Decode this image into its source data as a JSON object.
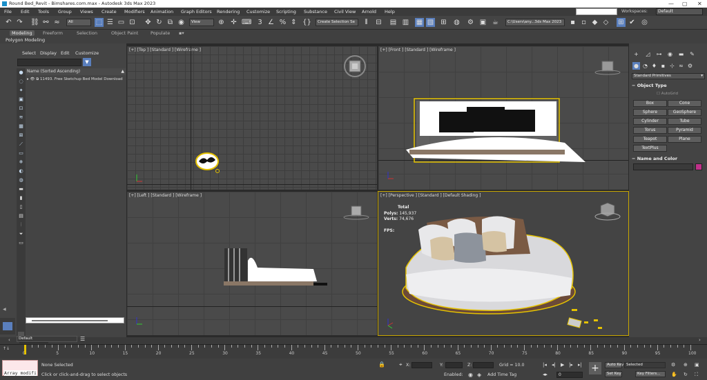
{
  "window": {
    "title": "Round Bed_Revit - Bimshares.com.max - Autodesk 3ds Max 2023",
    "controls": [
      "—",
      "▢",
      "✕"
    ]
  },
  "menu": [
    "File",
    "Edit",
    "Tools",
    "Group",
    "Views",
    "Create",
    "Modifiers",
    "Animation",
    "Graph Editors",
    "Rendering",
    "Customize",
    "Scripting",
    "Substance",
    "Civil View",
    "Arnold",
    "Help"
  ],
  "workspaces": {
    "label": "Workspaces:",
    "value": "Default"
  },
  "toolbar": {
    "selection_filter": "All",
    "ref_coord": "View",
    "named_selection": "Create Selection Se",
    "path": "C:\\Users\\any...3ds Max 2023"
  },
  "ribbon": {
    "tabs": [
      "Modeling",
      "Freeform",
      "Selection",
      "Object Paint",
      "Populate"
    ],
    "active": "Modeling",
    "sub": "Polygon Modeling"
  },
  "scene_explorer": {
    "menu": [
      "Select",
      "Display",
      "Edit",
      "Customize"
    ],
    "column_header": "Name (Sorted Ascending)",
    "row": "11493. Free Sketchup Bed Model Download"
  },
  "viewports": {
    "top": "[+] [Top ] [Standard ] [Wireframe ]",
    "front": "[+] [Front ] [Standard ] [Wireframe ]",
    "left": "[+] [Left ] [Standard ] [Wireframe ]",
    "perspective": "[+] [Perspective ] [Standard ] [Default Shading ]"
  },
  "stats": {
    "header": "Total",
    "polys_label": "Polys:",
    "polys": "145,937",
    "verts_label": "Verts:",
    "verts": "74,676",
    "fps_label": "FPS:"
  },
  "command_panel": {
    "category": "Standard Primitives",
    "object_type": "Object Type",
    "autogrid": "AutoGrid",
    "buttons": [
      "Box",
      "Cone",
      "Sphere",
      "GeoSphere",
      "Cylinder",
      "Tube",
      "Torus",
      "Pyramid",
      "Teapot",
      "Plane",
      "TextPlus"
    ],
    "name_and_color": "Name and Color",
    "color": "#c0308a"
  },
  "timeline": {
    "frame": "0 / 100",
    "ticks": [
      "0",
      "5",
      "10",
      "15",
      "20",
      "25",
      "30",
      "35",
      "40",
      "45",
      "50",
      "55",
      "60",
      "65",
      "70",
      "75",
      "80",
      "85",
      "90",
      "95",
      "100"
    ]
  },
  "status": {
    "layer": "Default",
    "maxscript": "Array modifi",
    "selected": "None Selected",
    "prompt": "Click or click-and-drag to select objects",
    "x_label": "X:",
    "y_label": "Y:",
    "z_label": "Z:",
    "grid": "Grid = 10.0",
    "enabled": "Enabled:",
    "add_time_tag": "Add Time Tag",
    "auto_key": "Auto Key",
    "set_key": "Set Key",
    "selected_dd": "Selected",
    "key_filters": "Key Filters...",
    "frame_field": "0"
  }
}
